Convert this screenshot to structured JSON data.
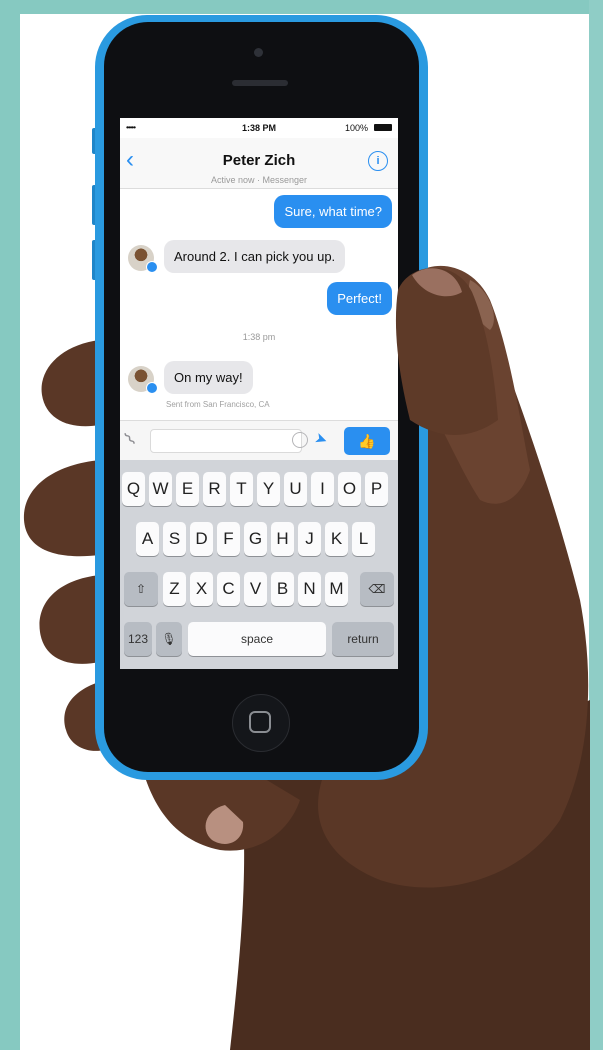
{
  "status_bar": {
    "signal": "•••••",
    "time": "1:38 PM",
    "battery": "100%"
  },
  "conversation": {
    "back_icon": "chevron-left-icon",
    "title": "Peter Zich",
    "subtitle": "Active now · Messenger",
    "info_icon": "info-icon"
  },
  "messages": [
    {
      "direction": "outgoing",
      "text": "Sure, what time?"
    },
    {
      "direction": "incoming",
      "text": "Around 2. I can pick you up."
    },
    {
      "direction": "outgoing",
      "text": "Perfect!"
    },
    {
      "direction": "timestamp",
      "text": "1:38 pm"
    },
    {
      "direction": "incoming",
      "text": "On my way!",
      "footer": "Sent from San Francisco, CA"
    }
  ],
  "composer": {
    "attach_icon": "paperclip-icon",
    "placeholder": "",
    "emoji_icon": "emoji-icon",
    "location_icon": "location-arrow-icon",
    "like_icon": "thumbs-up-icon"
  },
  "keyboard": {
    "row1": [
      "Q",
      "W",
      "E",
      "R",
      "T",
      "Y",
      "U",
      "I",
      "O",
      "P"
    ],
    "row2": [
      "A",
      "S",
      "D",
      "F",
      "G",
      "H",
      "J",
      "K",
      "L"
    ],
    "row3": [
      "Z",
      "X",
      "C",
      "V",
      "B",
      "N",
      "M"
    ],
    "shift_icon": "shift-icon",
    "delete_icon": "backspace-icon",
    "numbers_label": "123",
    "mic_icon": "microphone-icon",
    "space_label": "space",
    "return_label": "return"
  },
  "colors": {
    "messenger_blue": "#2a8ff0",
    "phone_body": "#2a9ae0",
    "background_teal": "#86c9c1"
  }
}
